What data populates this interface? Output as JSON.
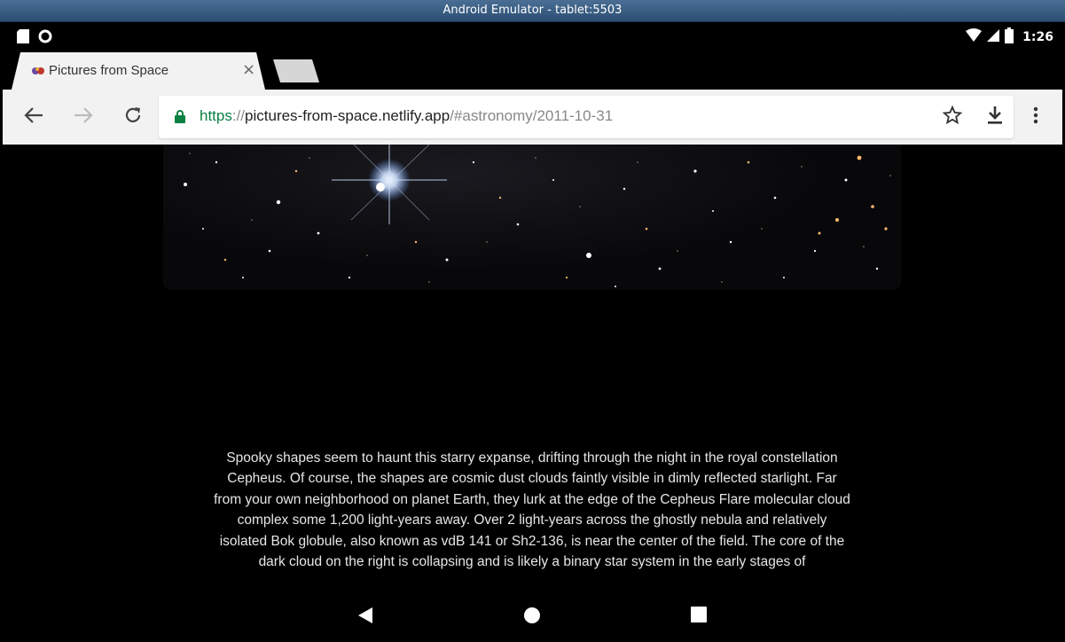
{
  "window": {
    "title": "Android Emulator - tablet:5503"
  },
  "status_bar": {
    "time": "1:26"
  },
  "tab": {
    "title": "Pictures from Space",
    "close_label": "×"
  },
  "toolbar": {
    "url_scheme": "https",
    "url_separator": "://",
    "url_host": "pictures-from-space.netlify.app",
    "url_path": "/#astronomy/2011-10-31"
  },
  "content": {
    "description": "Spooky shapes seem to haunt this starry expanse, drifting through the night in the royal constellation Cepheus. Of course, the shapes are cosmic dust clouds faintly visible in dimly reflected starlight. Far from your own neighborhood on planet Earth, they lurk at the edge of the Cepheus Flare molecular cloud complex some 1,200 light-years away. Over 2 light-years across the ghostly nebula and relatively isolated Bok globule, also known as vdB 141 or Sh2-136, is near the center of the field. The core of the dark cloud on the right is collapsing and is likely a binary star system in the early stages of"
  },
  "icons": {
    "sd_card": "sd-card-icon",
    "circle": "circle-icon",
    "wifi": "wifi-icon",
    "signal": "signal-icon",
    "battery": "battery-icon",
    "favicon": "favicon-icon",
    "back": "back-arrow-icon",
    "forward": "forward-arrow-icon",
    "reload": "reload-icon",
    "lock": "lock-icon",
    "star": "star-icon",
    "download": "download-icon",
    "menu": "more-vert-icon",
    "nav_back": "nav-back-icon",
    "nav_home": "nav-home-icon",
    "nav_recents": "nav-recents-icon"
  },
  "colors": {
    "url_scheme": "#0b8043",
    "chrome_bg": "#f2f2f2",
    "page_bg": "#000000"
  }
}
